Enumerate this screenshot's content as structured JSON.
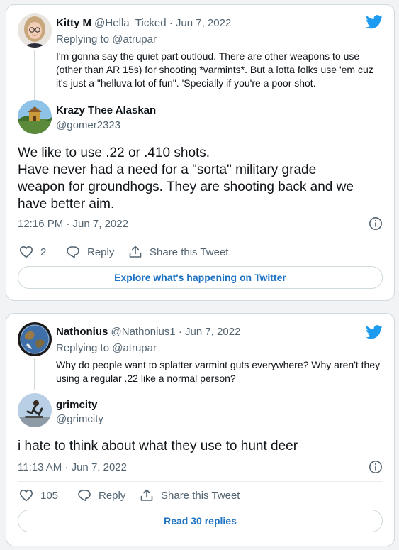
{
  "colors": {
    "twitter_blue": "#1d9bf0",
    "link_blue": "#1d72c2",
    "muted_text": "#536471",
    "border": "#cfd9de"
  },
  "tweets": [
    {
      "quoted": {
        "name": "Kitty M",
        "handle": "@Hella_Ticked",
        "separator": "·",
        "date": "Jun 7, 2022",
        "replying_to": "Replying to @atrupar",
        "text": "I'm gonna say the quiet part outloud. There are other weapons to use (other than AR 15s) for shooting *varmints*. But a lotta folks use 'em cuz it's just a \"helluva lot of fun\". 'Specially if you're a poor shot."
      },
      "author": {
        "name": "Krazy Thee Alaskan",
        "handle": "@gomer2323"
      },
      "text_lines": [
        "We like to use .22 or .410 shots.",
        "Have never had a need for a \"sorta\" military grade",
        "weapon for groundhogs. They are shooting back and we",
        "have better aim."
      ],
      "timestamp": "12:16 PM · Jun 7, 2022",
      "actions": {
        "like_icon": "heart-icon",
        "like_count": "2",
        "reply_icon": "speech-bubble-icon",
        "reply_label": "Reply",
        "share_icon": "share-icon",
        "share_label": "Share this Tweet"
      },
      "cta_label": "Explore what's happening on Twitter"
    },
    {
      "quoted": {
        "name": "Nathonius",
        "handle": "@Nathonius1",
        "separator": "·",
        "date": "Jun 7, 2022",
        "replying_to": "Replying to @atrupar",
        "text": "Why do people want to splatter varmint guts everywhere? Why aren't they using a regular .22 like a normal person?"
      },
      "author": {
        "name": "grimcity",
        "handle": "@grimcity"
      },
      "text_lines": [
        "i hate to think about what they use to hunt deer"
      ],
      "timestamp": "11:13 AM · Jun 7, 2022",
      "actions": {
        "like_icon": "heart-icon",
        "like_count": "105",
        "reply_icon": "speech-bubble-icon",
        "reply_label": "Reply",
        "share_icon": "share-icon",
        "share_label": "Share this Tweet"
      },
      "cta_label": "Read 30 replies"
    }
  ]
}
